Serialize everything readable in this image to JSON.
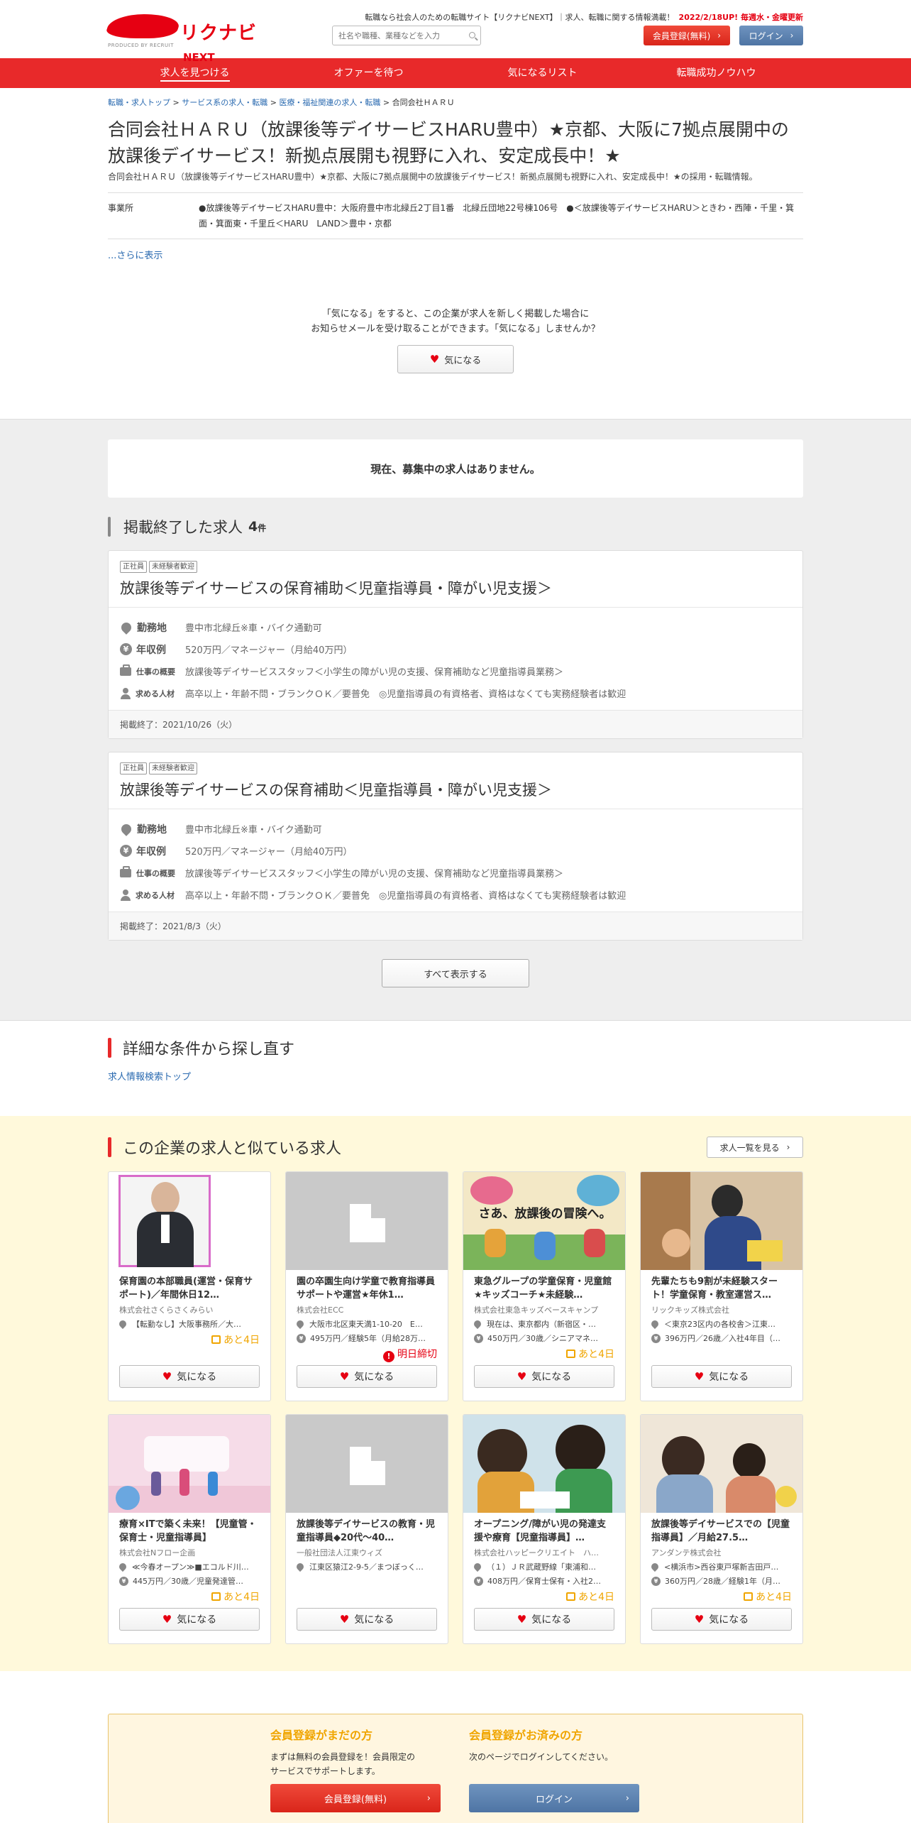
{
  "header": {
    "logo_main": "リクナビ",
    "logo_next": "NEXT",
    "logo_sub": "PRODUCED BY RECRUIT",
    "tagline": "転職なら社会人のための転職サイト【リクナビNEXT】｜求人、転職に関する情報満載！",
    "update_note": "2022/2/18UP! 毎週水・金曜更新",
    "search_placeholder": "社名や職種、業種などを入力",
    "register_label": "会員登録(無料)",
    "login_label": "ログイン"
  },
  "nav": {
    "items": [
      "求人を見つける",
      "オファーを待つ",
      "気になるリスト",
      "転職成功ノウハウ"
    ]
  },
  "breadcrumb": {
    "items": [
      "転職・求人トップ",
      "サービス系の求人・転職",
      "医療・福祉関連の求人・転職"
    ],
    "current": "合同会社ＨＡＲＵ"
  },
  "company": {
    "title": "合同会社ＨＡＲＵ（放課後等デイサービスHARU豊中）★京都、大阪に7拠点展開中の放課後デイサービス！新拠点展開も視野に入れ、安定成長中！★",
    "subtitle": "合同会社ＨＡＲＵ（放課後等デイサービスHARU豊中）★京都、大阪に7拠点展開中の放課後デイサービス！新拠点展開も視野に入れ、安定成長中！★の採用・転職情報。",
    "office_label": "事業所",
    "office_value": "●放課後等デイサービスHARU豊中：大阪府豊中市北緑丘2丁目1番　北緑丘団地22号棟106号　●＜放課後等デイサービスHARU＞ときわ・西陣・千里・箕面・箕面東・千里丘＜HARU　LAND＞豊中・京都",
    "more_label": "...さらに表示"
  },
  "favorite": {
    "message_1": "「気になる」をすると、この企業が求人を新しく掲載した場合に",
    "message_2": "お知らせメールを受け取ることができます。「気になる」しませんか？",
    "button_label": "気になる"
  },
  "current_jobs": {
    "empty_message": "現在、募集中の求人はありません。"
  },
  "ended_jobs": {
    "heading": "掲載終了した求人",
    "count": "4",
    "count_unit": "件",
    "labels": {
      "location": "勤務地",
      "salary": "年収例",
      "summary": "仕事の概要",
      "requirements": "求める人材"
    },
    "items": [
      {
        "tags": [
          "正社員",
          "未経験者歓迎"
        ],
        "title": "放課後等デイサービスの保育補助＜児童指導員・障がい児支援＞",
        "location": "豊中市北緑丘※車・バイク通勤可",
        "salary": "520万円／マネージャー（月給40万円）",
        "summary": "放課後等デイサービススタッフ＜小学生の障がい児の支援、保育補助など児童指導員業務＞",
        "requirements": "高卒以上・年齢不問・ブランクＯＫ／要普免　◎児童指導員の有資格者、資格はなくても実務経験者は歓迎",
        "ended": "掲載終了：2021/10/26（火）"
      },
      {
        "tags": [
          "正社員",
          "未経験者歓迎"
        ],
        "title": "放課後等デイサービスの保育補助＜児童指導員・障がい児支援＞",
        "location": "豊中市北緑丘※車・バイク通勤可",
        "salary": "520万円／マネージャー（月給40万円）",
        "summary": "放課後等デイサービススタッフ＜小学生の障がい児の支援、保育補助など児童指導員業務＞",
        "requirements": "高卒以上・年齢不問・ブランクＯＫ／要普免　◎児童指導員の有資格者、資格はなくても実務経験者は歓迎",
        "ended": "掲載終了：2021/8/3（火）"
      }
    ],
    "show_all_label": "すべて表示する"
  },
  "detail_search": {
    "heading": "詳細な条件から探し直す",
    "link": "求人情報検索トップ"
  },
  "similar": {
    "heading": "この企業の求人と似ている求人",
    "list_button": "求人一覧を見る",
    "fav_label": "気になる",
    "cards": [
      {
        "title": "保育園の本部職員(運営・保育サポート)／年間休日12…",
        "company": "株式会社さくらさくみらい",
        "location": "【転勤なし】大阪事務所／大…",
        "salary": "",
        "badge": "あと4日",
        "badge_type": "days",
        "thumb": "photo-man"
      },
      {
        "title": "園の卒園生向け学童で教育指導員サポートや運営★年休1…",
        "company": "株式会社ECC",
        "location": "大阪市北区東天満1-10-20　E…",
        "salary": "495万円／経験5年（月給28万…",
        "badge": "明日締切",
        "badge_type": "deadline",
        "thumb": "none"
      },
      {
        "title": "東急グループの学童保育・児童館★キッズコーチ★未経験…",
        "company": "株式会社東急キッズベースキャンプ",
        "location": "現在は、東京都内（新宿区・…",
        "salary": "450万円／30歳／シニアマネ…",
        "badge": "あと4日",
        "badge_type": "days",
        "thumb": "photo-kids",
        "thumb_text": "さあ、放課後の冒険へ。"
      },
      {
        "title": "先輩たちも9割が未経験スタート！学童保育・教室運営ス…",
        "company": "リックキッズ株式会社",
        "location": "＜東京23区内の各校舎＞江東…",
        "salary": "396万円／26歳／入社4年目（…",
        "badge": "",
        "badge_type": "none",
        "thumb": "photo-teacher"
      },
      {
        "title": "療育×ITで築く未来！【児童管・保育士・児童指導員】",
        "company": "株式会社Nフロー企画",
        "location": "≪今春オープン≫■エコルド川…",
        "salary": "445万円／30歳／児童発達管…",
        "badge": "あと4日",
        "badge_type": "days",
        "thumb": "photo-room"
      },
      {
        "title": "放課後等デイサービスの教育・児童指導員◆20代～40…",
        "company": "一般社団法人江東ウィズ",
        "location": "江東区猿江2-9-5／まつぼっく…",
        "salary": "",
        "badge": "",
        "badge_type": "none",
        "thumb": "none"
      },
      {
        "title": "オープニング/障がい児の発達支援や療育【児童指導員】…",
        "company": "株式会社ハッピークリエイト　ハ…",
        "location": "（１）ＪＲ武蔵野線「東浦和…",
        "salary": "408万円／保育士保有・入社2…",
        "badge": "あと4日",
        "badge_type": "days",
        "thumb": "photo-study"
      },
      {
        "title": "放課後等デイサービスでの【児童指導員】／月給27.5…",
        "company": "アンダンテ株式会社",
        "location": "<横浜市>西谷東戸塚新吉田戸…",
        "salary": "360万円／28歳／経験1年（月…",
        "badge": "あと4日",
        "badge_type": "days",
        "thumb": "photo-play"
      }
    ]
  },
  "login_box": {
    "new_heading": "会員登録がまだの方",
    "new_text_1": "まずは無料の会員登録を！会員限定の",
    "new_text_2": "サービスでサポートします。",
    "new_button": "会員登録(無料)",
    "member_heading": "会員登録がお済みの方",
    "member_text": "次のページでログインしてください。",
    "member_button": "ログイン"
  },
  "colors": {
    "brand_red": "#e8292a",
    "link_blue": "#2a6ab0",
    "badge_orange": "#f0a500",
    "similar_bg": "#fff9db"
  }
}
